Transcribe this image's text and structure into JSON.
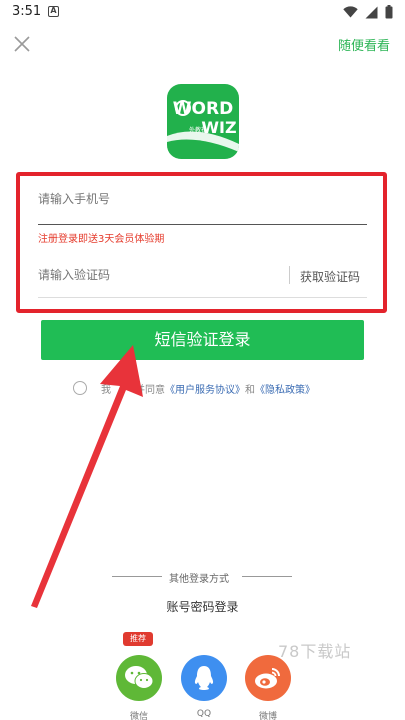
{
  "status_bar": {
    "time": "3:51",
    "notif_letter": "A"
  },
  "header": {
    "skip_label": "随便看看"
  },
  "logo": {
    "line1": "WORD",
    "line2": "WIZ",
    "small": "外教社"
  },
  "form": {
    "phone_placeholder": "请输入手机号",
    "hint": "注册登录即送3天会员体验期",
    "code_placeholder": "请输入验证码",
    "get_code_label": "获取验证码"
  },
  "login_button_label": "短信验证登录",
  "agreement": {
    "prefix": "我",
    "middle": "并同意",
    "user_agreement": "《用户服务协议》",
    "and": "和",
    "privacy": "《隐私政策》"
  },
  "other": {
    "title": "其他登录方式",
    "password_login": "账号密码登录"
  },
  "social": {
    "badge": "推荐",
    "wechat": "微信",
    "qq": "QQ",
    "weibo": "微博"
  },
  "watermark": "78下载站",
  "colors": {
    "accent": "#20bd55",
    "highlight": "#e3232c",
    "hint": "#e53b2c"
  }
}
